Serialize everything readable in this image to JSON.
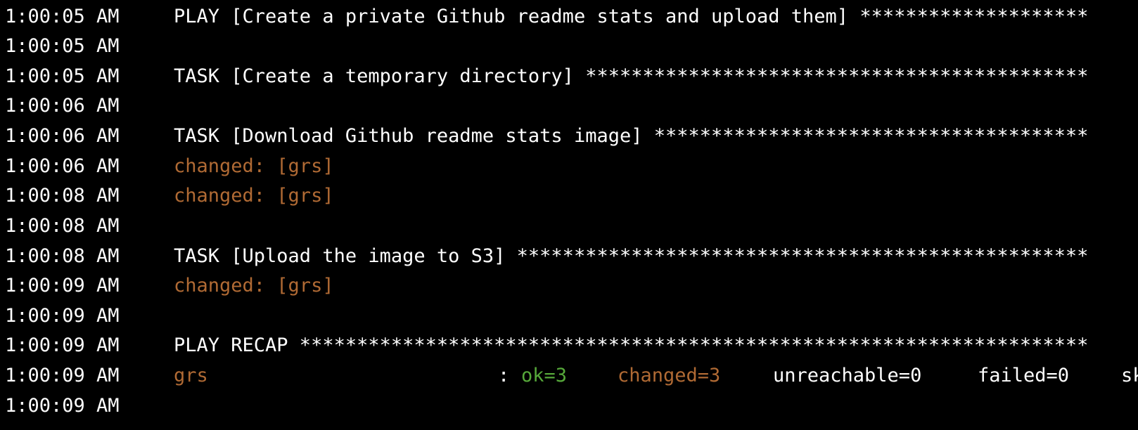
{
  "colors": {
    "background": "#000000",
    "text": "#ffffff",
    "changed": "#b06a34",
    "ok": "#56a83a"
  },
  "lines": [
    {
      "ts": "1:00:05 AM",
      "text": "PLAY [Create a private Github readme stats and upload them] ********************"
    },
    {
      "ts": "1:00:05 AM",
      "text": ""
    },
    {
      "ts": "1:00:05 AM",
      "text": "TASK [Create a temporary directory] ********************************************"
    },
    {
      "ts": "1:00:06 AM",
      "text": ""
    },
    {
      "ts": "1:00:06 AM",
      "text": "TASK [Download Github readme stats image] **************************************"
    },
    {
      "ts": "1:00:06 AM",
      "text": "changed: [grs]"
    },
    {
      "ts": "1:00:08 AM",
      "text": "changed: [grs]"
    },
    {
      "ts": "1:00:08 AM",
      "text": ""
    },
    {
      "ts": "1:00:08 AM",
      "text": "TASK [Upload the image to S3] **************************************************"
    },
    {
      "ts": "1:00:09 AM",
      "text": "changed: [grs]"
    },
    {
      "ts": "1:00:09 AM",
      "text": ""
    },
    {
      "ts": "1:00:09 AM",
      "text": "PLAY RECAP *********************************************************************"
    },
    {
      "ts": "1:00:09 AM",
      "recap": {
        "host": "grs",
        "sep": ": ",
        "ok": "ok=3",
        "changed": "changed=3",
        "unreachable": "unreachable=0",
        "failed": "failed=0",
        "skipped": "sk"
      }
    },
    {
      "ts": "1:00:09 AM",
      "text": ""
    }
  ]
}
